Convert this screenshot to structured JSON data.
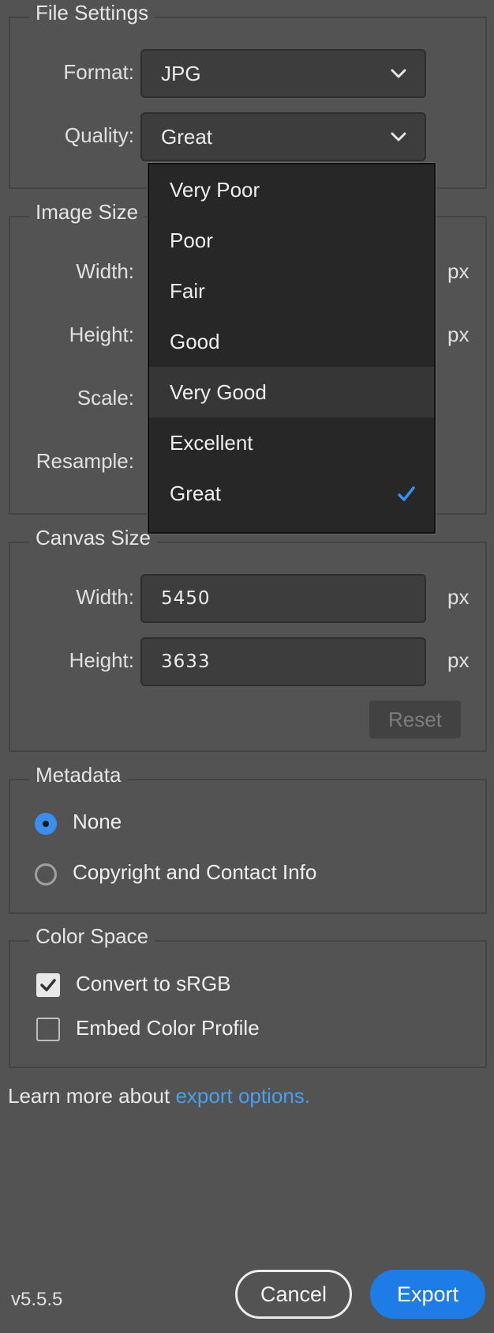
{
  "file_settings": {
    "legend": "File Settings",
    "format_label": "Format:",
    "format_value": "JPG",
    "quality_label": "Quality:",
    "quality_value": "Great"
  },
  "quality_dropdown": {
    "options": [
      "Very Poor",
      "Poor",
      "Fair",
      "Good",
      "Very Good",
      "Excellent",
      "Great"
    ],
    "highlighted": "Very Good",
    "selected": "Great"
  },
  "image_size": {
    "legend": "Image Size",
    "width_label": "Width:",
    "height_label": "Height:",
    "scale_label": "Scale:",
    "resample_label": "Resample:",
    "unit": "px"
  },
  "canvas_size": {
    "legend": "Canvas Size",
    "width_label": "Width:",
    "width_value": "5450",
    "height_label": "Height:",
    "height_value": "3633",
    "unit": "px",
    "reset_label": "Reset"
  },
  "metadata": {
    "legend": "Metadata",
    "options": [
      "None",
      "Copyright and Contact Info"
    ],
    "selected": "None"
  },
  "color_space": {
    "legend": "Color Space",
    "convert_label": "Convert to sRGB",
    "convert_checked": true,
    "embed_label": "Embed Color Profile",
    "embed_checked": false
  },
  "footer": {
    "learn_prefix": "Learn more about ",
    "learn_link": "export options.",
    "version": "v5.5.5",
    "cancel_label": "Cancel",
    "export_label": "Export"
  },
  "colors": {
    "background": "#535353",
    "accent": "#1d7ce6",
    "link": "#4a9fef",
    "dropdown_bg": "#272727"
  }
}
